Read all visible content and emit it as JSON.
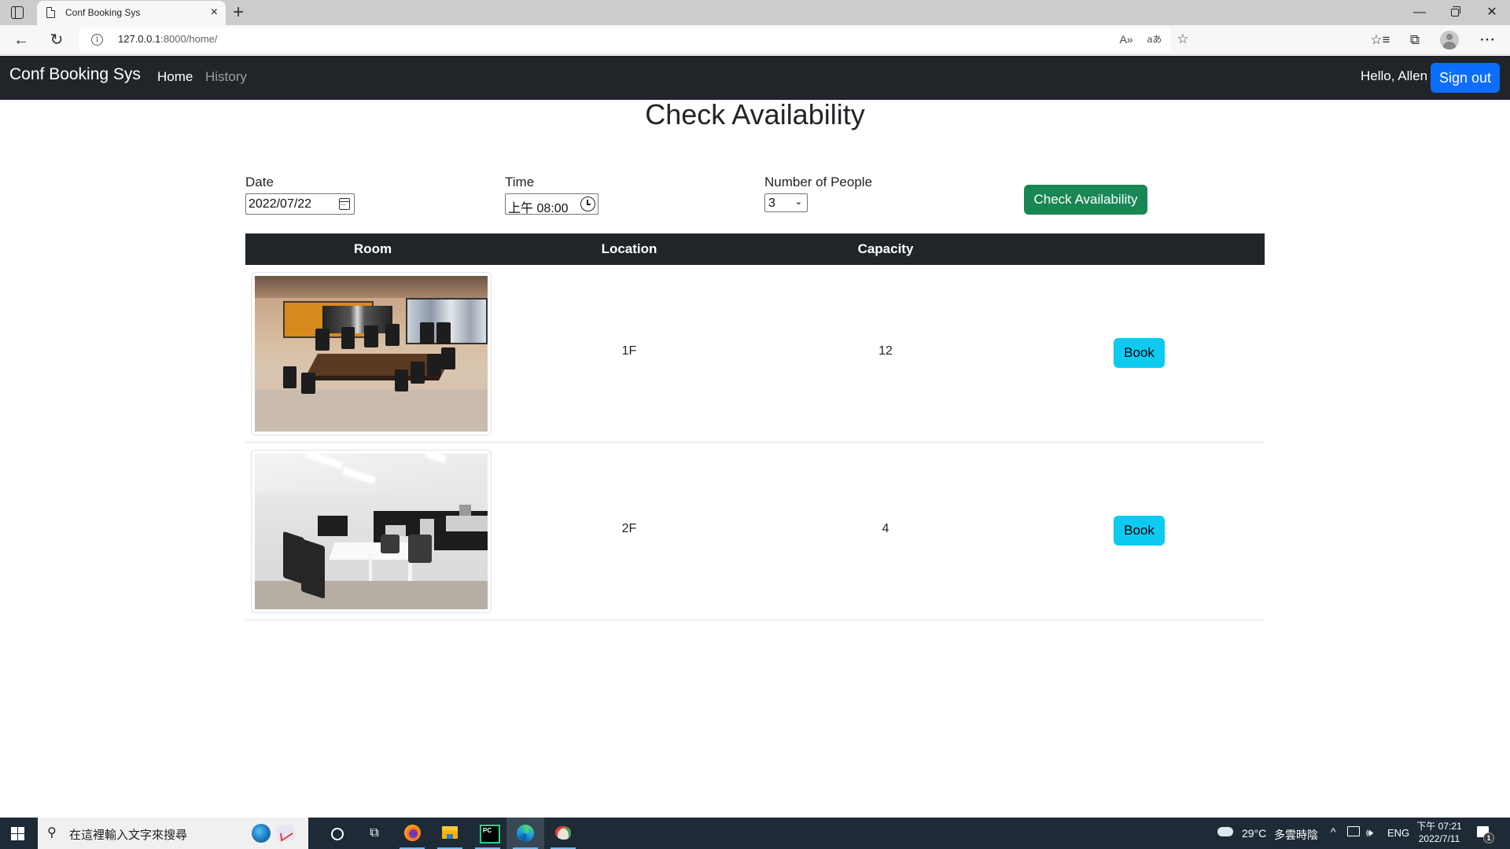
{
  "browser": {
    "tab_title": "Conf Booking Sys",
    "tab_close_glyph": "×",
    "new_tab_glyph": "+",
    "url_host": "127.0.0.1",
    "url_rest": ":8000/home/",
    "window_controls": {
      "minimize": "—",
      "close": "✕"
    },
    "toolbar_icons": {
      "back": "←",
      "reload": "↻",
      "info": "i",
      "read_aloud": "A»",
      "translate": "aあ",
      "add_favorite": "☆",
      "favorites": "☆≡",
      "collections": "⧉",
      "more": "···"
    }
  },
  "navbar": {
    "brand": "Conf Booking Sys",
    "links": [
      {
        "label": "Home",
        "active": true
      },
      {
        "label": "History",
        "active": false
      }
    ],
    "greeting": "Hello, Allen",
    "signout_label": "Sign out"
  },
  "page": {
    "title": "Check Availability",
    "form": {
      "date_label": "Date",
      "date_value": "2022/07/22",
      "time_label": "Time",
      "time_value": "上午 08:00",
      "people_label": "Number of People",
      "people_value": "3",
      "people_chevron": "⌄",
      "submit_label": "Check Availability"
    },
    "table": {
      "columns": [
        "Room",
        "Location",
        "Capacity",
        ""
      ],
      "rows": [
        {
          "image": "conference-room-warm-boardroom",
          "location": "1F",
          "capacity": "12",
          "action": "Book"
        },
        {
          "image": "conference-room-white-minimal",
          "location": "2F",
          "capacity": "4",
          "action": "Book"
        }
      ]
    }
  },
  "colors": {
    "navbar_bg": "#212529",
    "signout_bg": "#0d6efd",
    "check_btn_bg": "#198754",
    "book_btn_bg": "#0dcaf0",
    "table_head_bg": "#212529"
  },
  "taskbar": {
    "search_placeholder": "在這裡輸入文字來搜尋",
    "search_icon": "⚲",
    "taskview_glyph": "⧉",
    "apps": [
      "cortana",
      "task-view",
      "firefox",
      "file-explorer",
      "pycharm",
      "edge",
      "paint"
    ],
    "weather_temp": "29°C",
    "weather_condition": "多雲時陰",
    "tray_chevron": "^",
    "volume_glyph": "🕪",
    "language": "ENG",
    "clock_time": "下午 07:21",
    "clock_date": "2022/7/11",
    "notification_count": "1"
  }
}
